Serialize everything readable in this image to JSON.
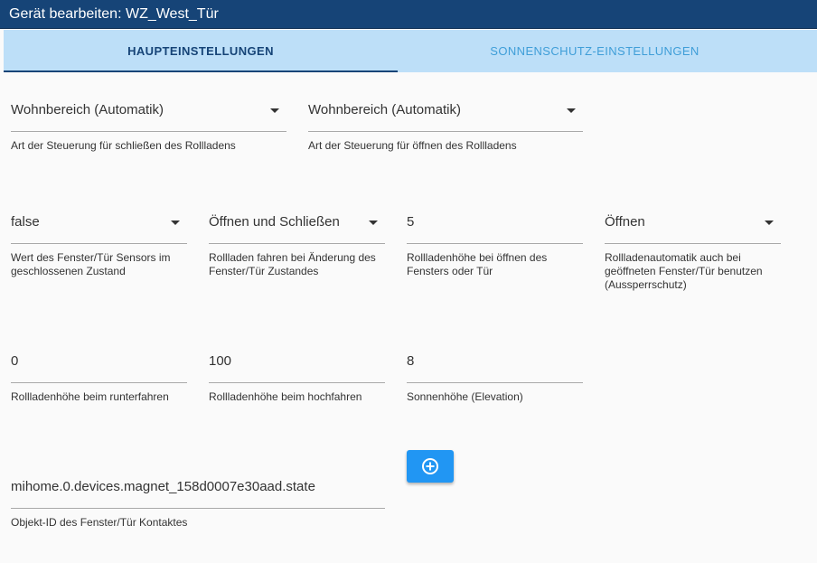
{
  "window": {
    "title": "Gerät bearbeiten: WZ_West_Tür"
  },
  "tabs": [
    {
      "label": "HAUPTEINSTELLUNGEN",
      "active": true
    },
    {
      "label": "SONNENSCHUTZ-EINSTELLUNGEN",
      "active": false
    }
  ],
  "row1": [
    {
      "value": "Wohnbereich (Automatik)",
      "label": "Art der Steuerung für schließen des Rollladens"
    },
    {
      "value": "Wohnbereich (Automatik)",
      "label": "Art der Steuerung für öffnen des Rollladens"
    }
  ],
  "row2": [
    {
      "value": "false",
      "label": "Wert des Fenster/Tür Sensors im geschlossenen Zustand"
    },
    {
      "value": "Öffnen und Schließen",
      "label": "Rollladen fahren bei Änderung des Fenster/Tür Zustandes"
    },
    {
      "value": "5",
      "label": "Rollladenhöhe bei öffnen des Fensters oder Tür"
    },
    {
      "value": "Öffnen",
      "label": "Rollladenautomatik auch bei geöffneten Fenster/Tür benutzen (Aussperrschutz)"
    }
  ],
  "row3": [
    {
      "value": "0",
      "label": "Rollladenhöhe beim runterfahren"
    },
    {
      "value": "100",
      "label": "Rollladenhöhe beim hochfahren"
    },
    {
      "value": "8",
      "label": "Sonnenhöhe (Elevation)"
    }
  ],
  "row4": [
    {
      "value": "mihome.0.devices.magnet_158d0007e30aad.state",
      "label": "Objekt-ID des Fenster/Tür Kontaktes"
    }
  ],
  "icons": {
    "add": "plus-circle-icon",
    "dropdown": "triangle-down-icon"
  },
  "colors": {
    "titlebar": "#164477",
    "tabbar": "#bddff8",
    "active_tab": "#164477",
    "inactive_tab": "#3f9ed8",
    "add_button": "#2196f3"
  }
}
